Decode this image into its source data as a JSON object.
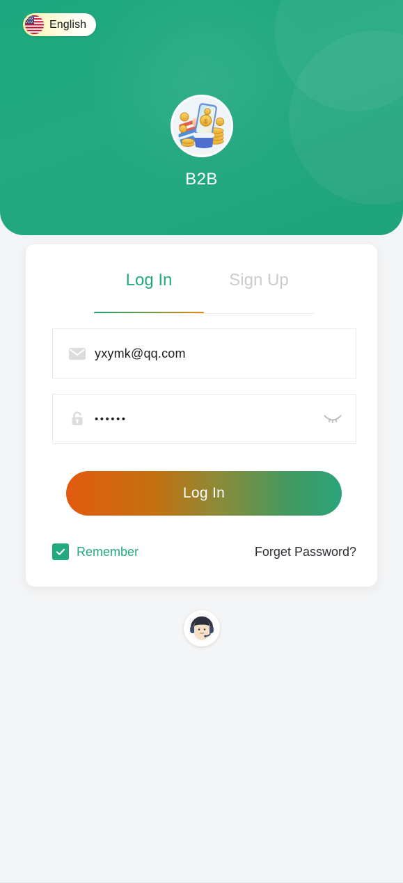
{
  "header": {
    "brand_title": "B2B",
    "logo_icon": "hand-holding-phone-with-coins-icon",
    "bg_color": "#21a87e"
  },
  "language": {
    "label": "English",
    "flag_icon": "us-flag-icon"
  },
  "tabs": [
    {
      "id": "login",
      "label": "Log In",
      "active": true
    },
    {
      "id": "signup",
      "label": "Sign Up",
      "active": false
    }
  ],
  "form": {
    "email": {
      "value": "yxymk@qq.com",
      "placeholder": "Email",
      "icon": "envelope-icon"
    },
    "password": {
      "value": "••••••",
      "placeholder": "Password",
      "icon": "lock-icon",
      "toggle_icon": "eye-closed-icon",
      "visible": false
    },
    "submit_label": "Log In",
    "remember": {
      "label": "Remember",
      "checked": true,
      "icon": "checkmark-icon"
    },
    "forget_password_label": "Forget Password?"
  },
  "support": {
    "icon": "headset-agent-icon"
  },
  "colors": {
    "brand_green": "#22a97f",
    "accent_orange": "#e25a0f",
    "muted_gray": "#c9cbcd",
    "page_bg": "#f4f5f6"
  }
}
